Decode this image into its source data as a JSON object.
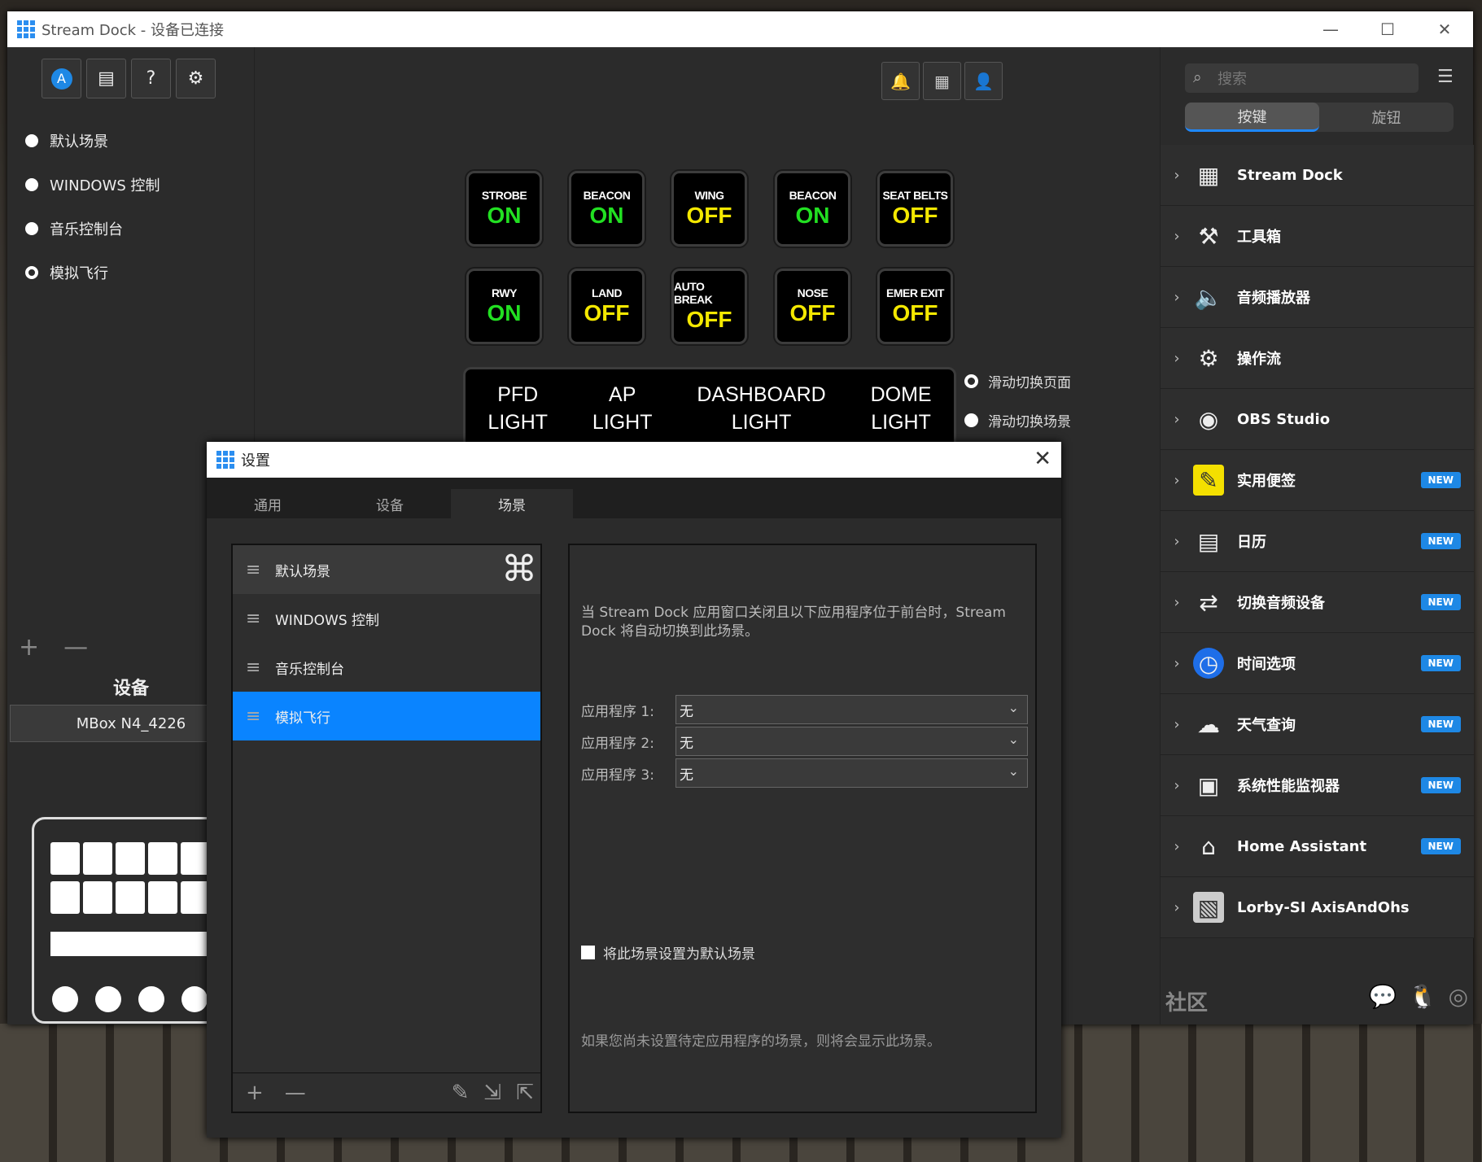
{
  "window": {
    "title": "Stream Dock - 设备已连接"
  },
  "scenes": [
    "默认场景",
    "WINDOWS 控制",
    "音乐控制台",
    "模拟飞行"
  ],
  "device": {
    "section_title": "设备",
    "name": "MBox N4_4226"
  },
  "keys": [
    {
      "label": "STROBE",
      "value": "ON",
      "state": "on"
    },
    {
      "label": "BEACON",
      "value": "ON",
      "state": "on"
    },
    {
      "label": "WING",
      "value": "OFF",
      "state": "off"
    },
    {
      "label": "BEACON",
      "value": "ON",
      "state": "on"
    },
    {
      "label": "SEAT BELTS",
      "value": "OFF",
      "state": "off"
    },
    {
      "label": "RWY",
      "value": "ON",
      "state": "on"
    },
    {
      "label": "LAND",
      "value": "OFF",
      "state": "off"
    },
    {
      "label": "AUTO BREAK",
      "value": "OFF",
      "state": "off"
    },
    {
      "label": "NOSE",
      "value": "OFF",
      "state": "off"
    },
    {
      "label": "EMER EXIT",
      "value": "OFF",
      "state": "off"
    }
  ],
  "touchbar": [
    [
      "PFD",
      "LIGHT"
    ],
    [
      "AP",
      "LIGHT"
    ],
    [
      "DASHBOARD",
      "LIGHT"
    ],
    [
      "DOME",
      "LIGHT"
    ]
  ],
  "swipe": {
    "page": "滑动切换页面",
    "scene": "滑动切换场景"
  },
  "search": {
    "placeholder": "搜索"
  },
  "right_tabs": {
    "keys": "按键",
    "knob": "旋钮"
  },
  "plugins": [
    {
      "name": "Stream Dock",
      "icon": "keypad-icon",
      "new": ""
    },
    {
      "name": "工具箱",
      "icon": "toolbox-icon",
      "new": ""
    },
    {
      "name": "音频播放器",
      "icon": "speaker-icon",
      "new": ""
    },
    {
      "name": "操作流",
      "icon": "flow-icon",
      "new": ""
    },
    {
      "name": "OBS Studio",
      "icon": "obs-icon",
      "new": ""
    },
    {
      "name": "实用便签",
      "icon": "note-icon",
      "new": "NEW"
    },
    {
      "name": "日历",
      "icon": "calendar-icon",
      "new": "NEW"
    },
    {
      "name": "切换音频设备",
      "icon": "audio-switch-icon",
      "new": "NEW"
    },
    {
      "name": "时间选项",
      "icon": "clock-icon",
      "new": "NEW"
    },
    {
      "name": "天气查询",
      "icon": "weather-icon",
      "new": "NEW"
    },
    {
      "name": "系统性能监视器",
      "icon": "monitor-icon",
      "new": "NEW"
    },
    {
      "name": "Home Assistant",
      "icon": "home-assistant-icon",
      "new": "NEW"
    },
    {
      "name": "Lorby-SI AxisAndOhs",
      "icon": "lorby-icon",
      "new": ""
    }
  ],
  "community": "社区",
  "dialog": {
    "title": "设置",
    "tabs": [
      "通用",
      "设备",
      "场景"
    ],
    "desc": "当 Stream Dock 应用窗口关闭且以下应用程序位于前台时，Stream Dock 将自动切换到此场景。",
    "apps": [
      {
        "label": "应用程序 1:",
        "value": "无"
      },
      {
        "label": "应用程序 2:",
        "value": "无"
      },
      {
        "label": "应用程序 3:",
        "value": "无"
      }
    ],
    "default_checkbox": "将此场景设置为默认场景",
    "note": "如果您尚未设置待定应用程序的场景，则将会显示此场景。"
  },
  "colors": {
    "accent": "#0a84ff",
    "on": "#22e022",
    "off": "#f4e800",
    "new_badge": "#1e88e5"
  }
}
